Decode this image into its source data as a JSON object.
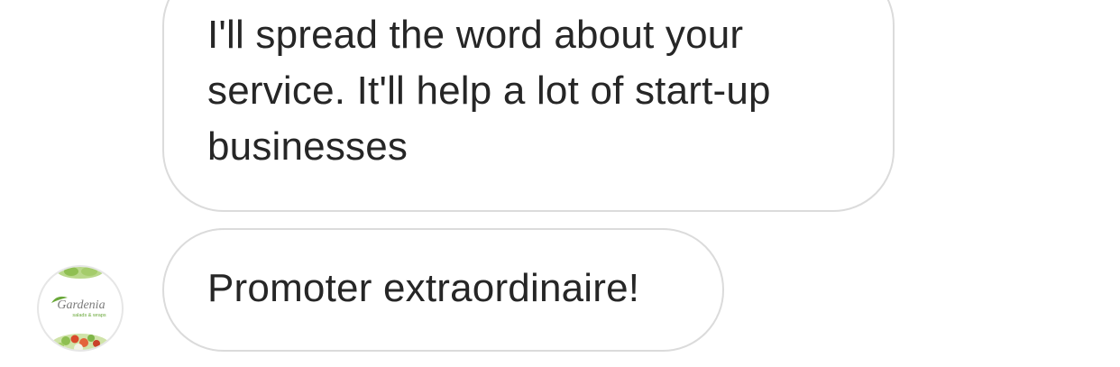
{
  "messages": [
    {
      "text": "I'll spread the word about your service. It'll help a lot of start-up businesses"
    },
    {
      "text": "Promoter extraordinaire!"
    }
  ],
  "sender": {
    "avatar_brand_text": "Gardenia",
    "avatar_tagline": "salads & wraps"
  },
  "colors": {
    "bubble_border": "#dbdbdb",
    "text": "#262626",
    "brand_green": "#6aa83a"
  }
}
